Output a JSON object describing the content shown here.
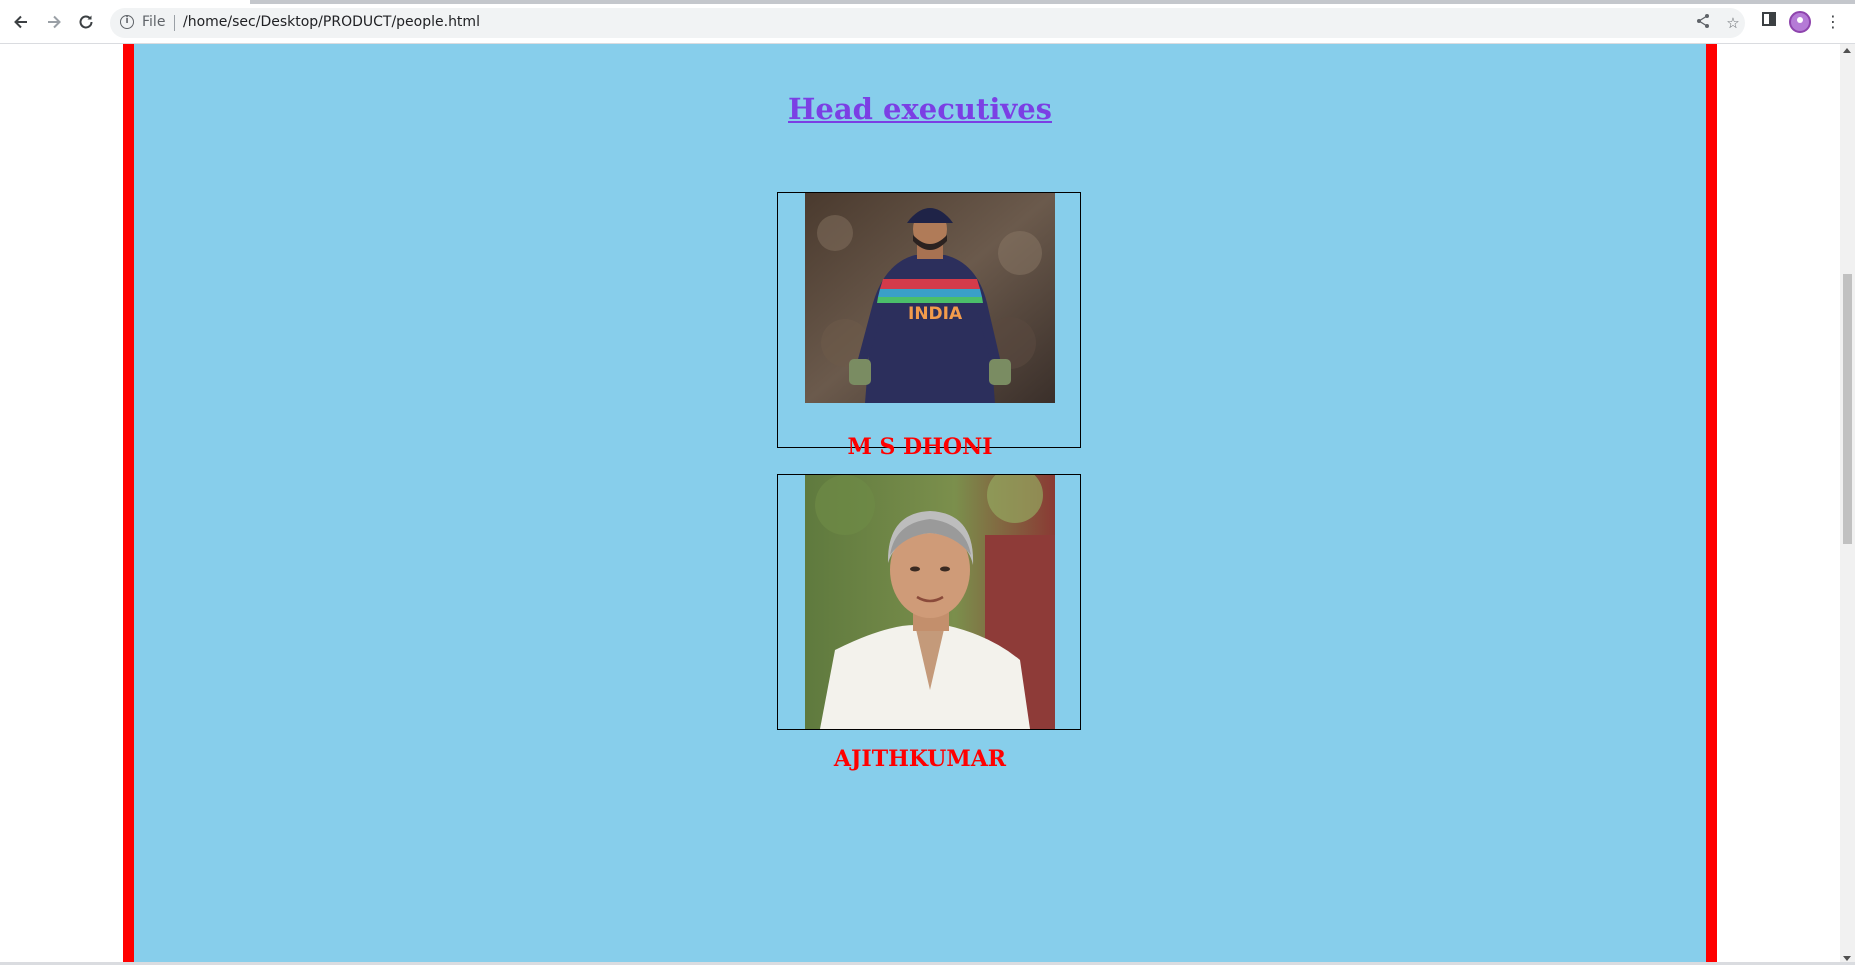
{
  "browser": {
    "back_icon": "arrow-left-icon",
    "forward_icon": "arrow-right-icon",
    "reload_icon": "reload-icon",
    "scheme_label": "File",
    "url": "/home/sec/Desktop/PRODUCT/people.html",
    "share_icon": "share-icon",
    "bookmark_icon": "star-icon",
    "sidepanel_icon": "side-panel-icon",
    "menu_icon": "kebab-menu-icon"
  },
  "page": {
    "panel_bg": "#87ceeb",
    "border_color": "#ff0000",
    "heading": "Head executives",
    "heading_color": "#7b3fe4",
    "people": [
      {
        "name": "M S DHONI",
        "photo": "cricketer in India jersey with wicket-keeping gloves"
      },
      {
        "name": "AJITHKUMAR",
        "photo": "grey-haired man in white shirt"
      }
    ]
  }
}
